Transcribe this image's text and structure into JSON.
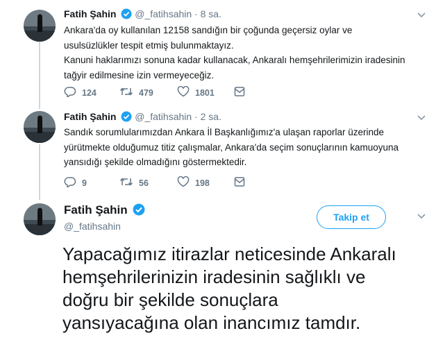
{
  "tweets": [
    {
      "name": "Fatih Şahin",
      "handle": "@_fatihsahin",
      "dot": "·",
      "time": "8 sa.",
      "lines": [
        "Ankara'da oy kullanılan 12158 sandığın bir çoğunda geçersiz oylar ve",
        "usulsüzlükler tespit etmiş bulunmaktayız.",
        "Kanuni haklarımızı sonuna kadar kullanacak, Ankaralı hemşehrilerimizin iradesinin",
        "tağyir edilmesine izin vermeyeceğiz."
      ],
      "replies": "124",
      "retweets": "479",
      "likes": "1801"
    },
    {
      "name": "Fatih Şahin",
      "handle": "@_fatihsahin",
      "dot": "·",
      "time": "2 sa.",
      "lines": [
        "Sandık sorumlularımızdan Ankara İl Başkanlığımız'a ulaşan raporlar üzerinde",
        "yürütmekte olduğumuz titiz çalışmalar, Ankara'da seçim sonuçlarının kamuoyuna",
        "yansıdığı şekilde olmadığını göstermektedir."
      ],
      "replies": "9",
      "retweets": "56",
      "likes": "198"
    }
  ],
  "main_tweet": {
    "name": "Fatih Şahin",
    "handle": "@_fatihsahin",
    "follow_label": "Takip et",
    "lines": [
      "Yapacağımız itirazlar neticesinde Ankaralı",
      "hemşehrilerinizin iradesinin sağlıklı ve",
      "doğru bir şekilde sonuçlara",
      "yansıyacağına olan inancımız tamdır."
    ]
  },
  "icons": [
    "verified-badge-icon",
    "caret-down-icon",
    "reply-icon",
    "retweet-icon",
    "like-icon",
    "share-icon"
  ],
  "colors": {
    "accent": "#1da1f2",
    "muted": "#657786",
    "text": "#14171a",
    "thread": "#ccd6dd"
  }
}
